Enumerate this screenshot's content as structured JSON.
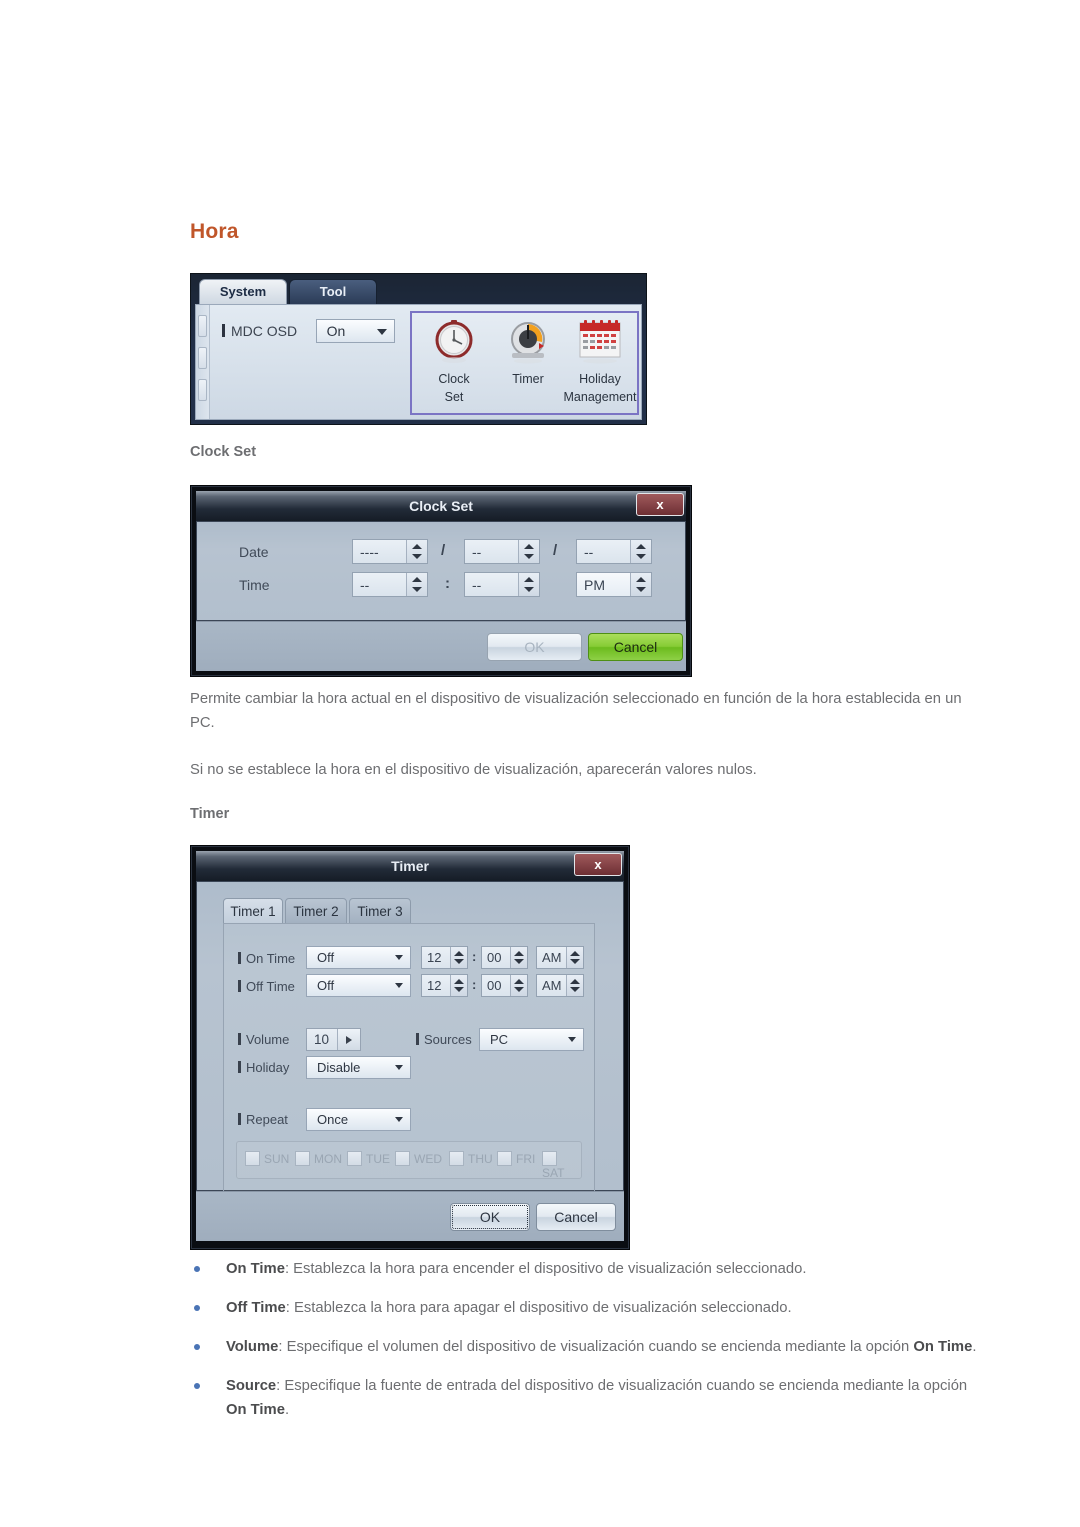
{
  "page": {
    "heading": "Hora",
    "section_clock": "Clock Set",
    "section_timer": "Timer",
    "paragraph1": "Permite cambiar la hora actual en el dispositivo de visualización seleccionado en función de la hora establecida en un PC.",
    "paragraph2": "Si no se establece la hora en el dispositivo de visualización, aparecerán valores nulos.",
    "heading_color": "#c0562a",
    "text_color": "#6d6e71"
  },
  "toolbar": {
    "tabs": [
      {
        "label": "System",
        "active": true
      },
      {
        "label": "Tool",
        "active": false
      }
    ],
    "osd": {
      "label": "MDC OSD",
      "value": "On"
    },
    "icon_group": {
      "highlight_color": "#7b74c4",
      "items": [
        {
          "name": "clock-set-icon",
          "caption_line1": "Clock",
          "caption_line2": "Set"
        },
        {
          "name": "timer-icon",
          "caption_line1": "Timer",
          "caption_line2": ""
        },
        {
          "name": "holiday-management-icon",
          "caption_line1": "Holiday",
          "caption_line2": "Management"
        }
      ]
    }
  },
  "clock_set_dialog": {
    "title": "Clock Set",
    "close_label": "x",
    "fields": [
      {
        "label": "Date",
        "spinners": [
          {
            "name": "year-spinner",
            "value": "----"
          },
          {
            "name": "month-spinner",
            "value": "--"
          },
          {
            "name": "day-spinner",
            "value": "--"
          }
        ],
        "separators": [
          "/",
          "/"
        ]
      },
      {
        "label": "Time",
        "spinners": [
          {
            "name": "hour-spinner",
            "value": "--"
          },
          {
            "name": "minute-spinner",
            "value": "--"
          },
          {
            "name": "meridiem-spinner",
            "value": "PM"
          }
        ],
        "separators": [
          ":",
          ""
        ]
      }
    ],
    "ok_label": "OK",
    "ok_disabled": true,
    "cancel_label": "Cancel",
    "cancel_color": "#86cc35"
  },
  "timer_dialog": {
    "title": "Timer",
    "close_label": "x",
    "tabs": [
      {
        "label": "Timer 1",
        "active": true
      },
      {
        "label": "Timer 2",
        "active": false
      },
      {
        "label": "Timer 3",
        "active": false
      }
    ],
    "on_time": {
      "label": "On Time",
      "mode": "Off",
      "hour": "12",
      "minute": "00",
      "meridiem": "AM"
    },
    "off_time": {
      "label": "Off Time",
      "mode": "Off",
      "hour": "12",
      "minute": "00",
      "meridiem": "AM"
    },
    "volume": {
      "label": "Volume",
      "value": "10"
    },
    "sources": {
      "label": "Sources",
      "value": "PC"
    },
    "holiday": {
      "label": "Holiday",
      "value": "Disable"
    },
    "repeat": {
      "label": "Repeat",
      "value": "Once"
    },
    "days": [
      {
        "label": "SUN",
        "checked": false
      },
      {
        "label": "MON",
        "checked": false
      },
      {
        "label": "TUE",
        "checked": false
      },
      {
        "label": "WED",
        "checked": false
      },
      {
        "label": "THU",
        "checked": false
      },
      {
        "label": "FRI",
        "checked": false
      },
      {
        "label": "SAT",
        "checked": false
      }
    ],
    "ok_label": "OK",
    "cancel_label": "Cancel"
  },
  "bullets": [
    {
      "term": "On Time",
      "rest": ": Establezca la hora para encender el dispositivo de visualización seleccionado."
    },
    {
      "term": "Off Time",
      "rest": ": Establezca la hora para apagar el dispositivo de visualización seleccionado."
    },
    {
      "term": "Volume",
      "rest": ": Especifique el volumen del dispositivo de visualización cuando se encienda mediante la opción ",
      "term2": "On Time",
      "tail": "."
    },
    {
      "term": "Source",
      "rest": ": Especifique la fuente de entrada del dispositivo de visualización cuando se encienda mediante la opción ",
      "term2": "On Time",
      "tail": "."
    }
  ]
}
